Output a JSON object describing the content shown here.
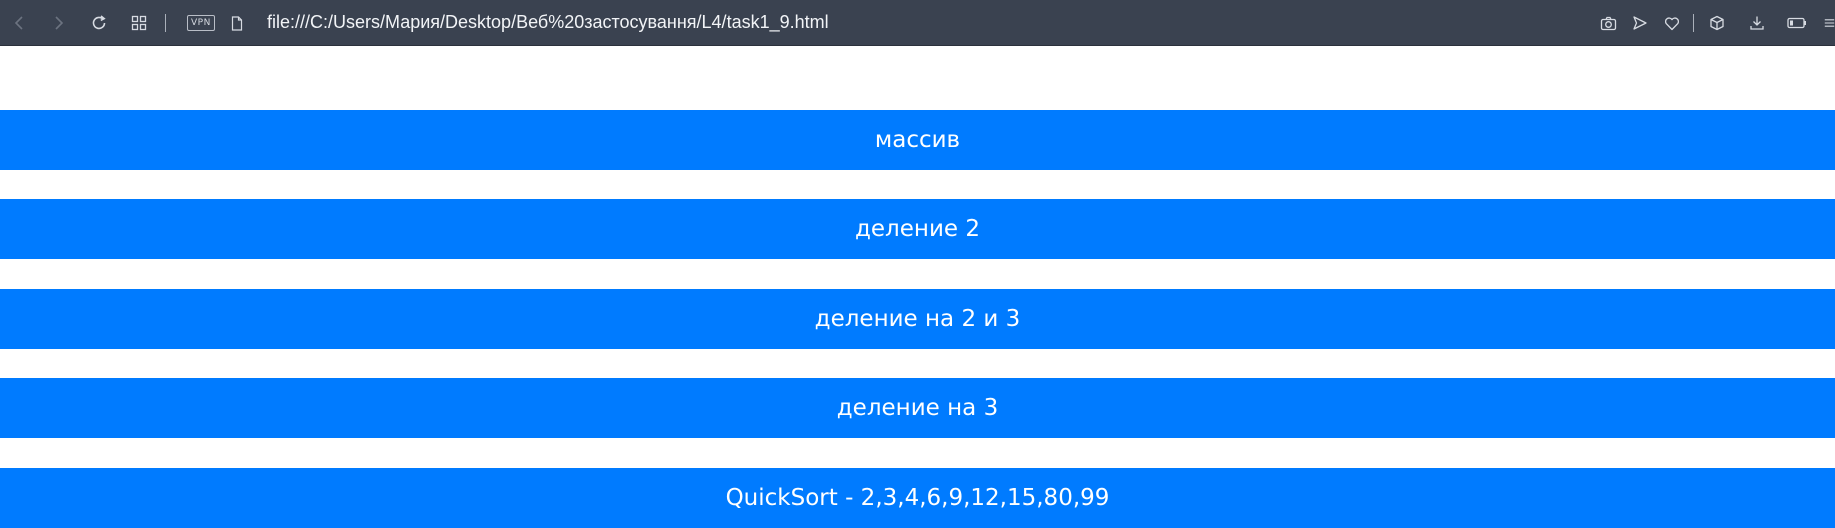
{
  "browser": {
    "url": "file:///C:/Users/Мария/Desktop/Веб%20застосування/L4/task1_9.html",
    "vpn_label": "VPN",
    "icons": {
      "back": "chevron-left-icon",
      "forward": "chevron-right-icon",
      "reload": "reload-icon",
      "tabs": "grid-icon",
      "page": "file-icon",
      "snapshot": "camera-icon",
      "send": "send-icon",
      "favorite": "heart-icon",
      "extensions": "cube-icon",
      "downloads": "download-icon",
      "battery": "battery-icon",
      "menu": "menu-icon"
    }
  },
  "buttons": [
    {
      "label": "массив"
    },
    {
      "label": "деление 2"
    },
    {
      "label": "деление на 2 и 3"
    },
    {
      "label": "деление на 3"
    },
    {
      "label": "QuickSort - 2,3,4,6,9,12,15,80,99"
    }
  ],
  "colors": {
    "button_bg": "#007bff",
    "button_text": "#ffffff",
    "toolbar_bg": "#3a4250"
  }
}
